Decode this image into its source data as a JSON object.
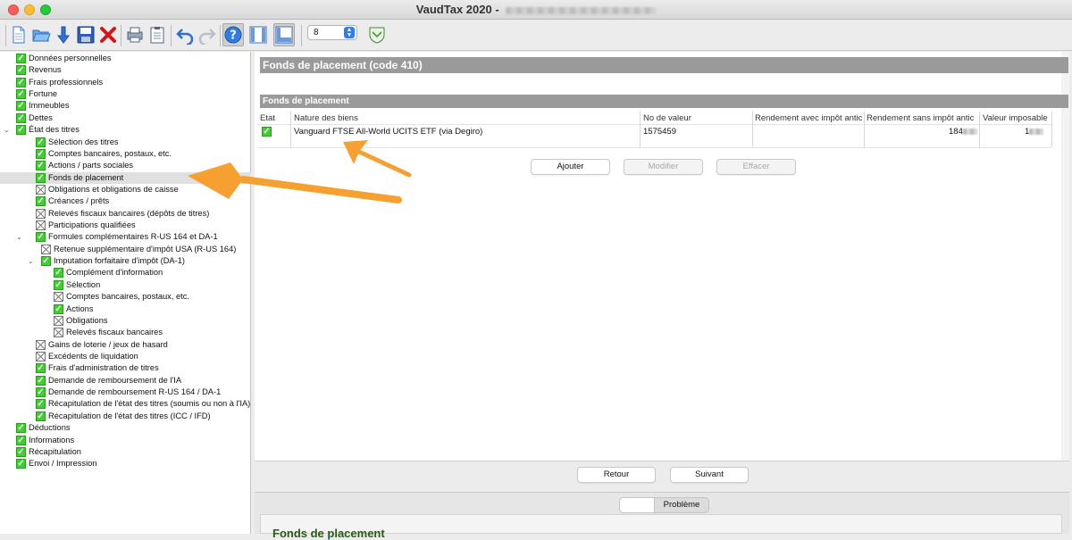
{
  "window": {
    "title": "VaudTax 2020 -"
  },
  "toolbar": {
    "icons": [
      "new-document-icon",
      "open-folder-icon",
      "download-icon",
      "save-icon",
      "delete-icon",
      "print-icon",
      "clipboard-icon",
      "undo-icon",
      "redo-icon",
      "help-icon",
      "layout-single-icon",
      "layout-split-icon",
      "vaud-crest-icon"
    ],
    "zoom_value": "8"
  },
  "tree": {
    "items": [
      {
        "label": "Données personnelles",
        "state": "ok"
      },
      {
        "label": "Revenus",
        "state": "ok"
      },
      {
        "label": "Frais professionnels",
        "state": "ok"
      },
      {
        "label": "Fortune",
        "state": "ok"
      },
      {
        "label": "Immeubles",
        "state": "ok"
      },
      {
        "label": "Dettes",
        "state": "ok"
      },
      {
        "label": "État des titres",
        "state": "ok"
      },
      {
        "label": "Sélection des titres",
        "state": "ok"
      },
      {
        "label": "Comptes bancaires, postaux, etc.",
        "state": "ok"
      },
      {
        "label": "Actions / parts sociales",
        "state": "ok"
      },
      {
        "label": "Fonds de placement",
        "state": "ok"
      },
      {
        "label": "Obligations et obligations de caisse",
        "state": "na"
      },
      {
        "label": "Créances / prêts",
        "state": "ok"
      },
      {
        "label": "Relevés fiscaux bancaires (dépôts de titres)",
        "state": "na"
      },
      {
        "label": "Participations qualifiées",
        "state": "na"
      },
      {
        "label": "Formules complémentaires R-US 164 et DA-1",
        "state": "ok"
      },
      {
        "label": "Retenue supplémentaire d'impôt USA (R-US 164)",
        "state": "na"
      },
      {
        "label": "Imputation forfaitaire d'impôt (DA-1)",
        "state": "ok"
      },
      {
        "label": "Complément d'information",
        "state": "ok"
      },
      {
        "label": "Sélection",
        "state": "ok"
      },
      {
        "label": "Comptes bancaires, postaux, etc.",
        "state": "na"
      },
      {
        "label": "Actions",
        "state": "ok"
      },
      {
        "label": "Obligations",
        "state": "na"
      },
      {
        "label": "Relevés fiscaux bancaires",
        "state": "na"
      },
      {
        "label": "Gains de loterie / jeux de hasard",
        "state": "na"
      },
      {
        "label": "Excédents de liquidation",
        "state": "na"
      },
      {
        "label": "Frais d'administration de titres",
        "state": "ok"
      },
      {
        "label": "Demande de remboursement de l'IA",
        "state": "ok"
      },
      {
        "label": "Demande de remboursement R-US 164 / DA-1",
        "state": "ok"
      },
      {
        "label": "Récapitulation de l'état des titres (soumis ou non à l'IA)",
        "state": "ok"
      },
      {
        "label": "Récapitulation de l'état des titres (ICC / IFD)",
        "state": "ok"
      },
      {
        "label": "Déductions",
        "state": "ok"
      },
      {
        "label": "Informations",
        "state": "ok"
      },
      {
        "label": "Récapitulation",
        "state": "ok"
      },
      {
        "label": "Envoi / Impression",
        "state": "ok"
      }
    ]
  },
  "main": {
    "page_title": "Fonds de placement (code 410)",
    "section_title": "Fonds de placement",
    "columns": [
      "Etat",
      "Nature des biens",
      "No de valeur",
      "Rendement avec impôt antic",
      "Rendement sans impôt antic",
      "Valeur imposable"
    ],
    "rows": [
      {
        "etat": "ok",
        "nature": "Vanguard FTSE All-World UCITS ETF (via Degiro)",
        "no_valeur": "1575459",
        "rendement_sans_prefix": "184",
        "valeur_prefix": "1"
      }
    ],
    "buttons": {
      "add": "Ajouter",
      "edit": "Modifier",
      "delete": "Effacer"
    },
    "nav": {
      "back": "Retour",
      "next": "Suivant"
    }
  },
  "lower": {
    "tab_label": "Problème",
    "panel_title": "Fonds de placement"
  },
  "colors": {
    "accent_arrow": "#f5a030",
    "check_green": "#3fcf2f",
    "section_bar": "#9a9a9a"
  }
}
